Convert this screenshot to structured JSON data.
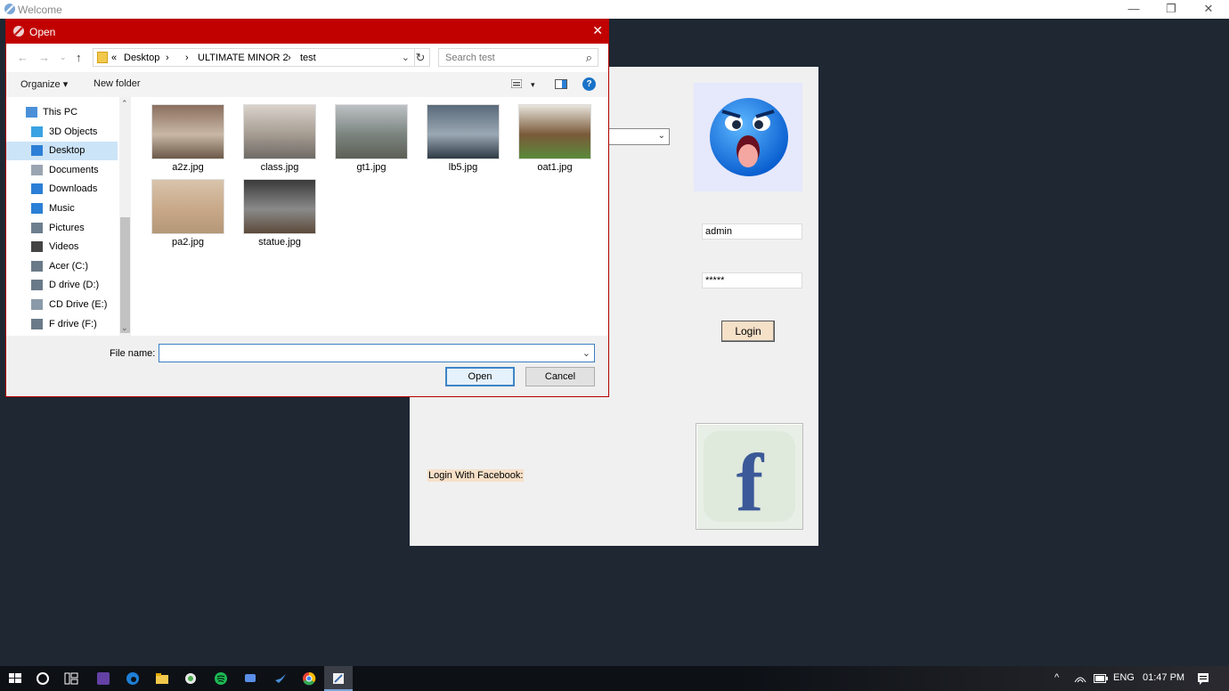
{
  "main_window": {
    "title": "Welcome",
    "minimize": "—",
    "maximize": "❐",
    "close": "✕"
  },
  "login_form": {
    "username_value": "admin",
    "password_value": "*****",
    "login_label": "Login",
    "facebook_label": "Login With Facebook:",
    "facebook_letter": "f"
  },
  "open_dialog": {
    "title": "Open",
    "close": "✕",
    "back": "←",
    "forward": "→",
    "recent": "⌄",
    "up": "↑",
    "breadcrumb": {
      "overflow": "«",
      "part1": "Desktop",
      "sep": "›",
      "part2": "ULTIMATE MINOR 2",
      "part3": "test"
    },
    "refresh": "↻",
    "search_placeholder": "Search test",
    "organize_label": "Organize ▾",
    "new_folder_label": "New folder",
    "view_options": "▾",
    "help": "?",
    "nav_items": [
      {
        "label": "This PC",
        "color": "#4a90d9"
      },
      {
        "label": "3D Objects",
        "color": "#3aa3e3"
      },
      {
        "label": "Desktop",
        "color": "#2c7fd6"
      },
      {
        "label": "Documents",
        "color": "#9aa5b1"
      },
      {
        "label": "Downloads",
        "color": "#2c7fd6"
      },
      {
        "label": "Music",
        "color": "#2c7fd6"
      },
      {
        "label": "Pictures",
        "color": "#6d7e8f"
      },
      {
        "label": "Videos",
        "color": "#444"
      },
      {
        "label": "Acer (C:)",
        "color": "#6a7a88"
      },
      {
        "label": "D drive (D:)",
        "color": "#6a7a88"
      },
      {
        "label": "CD Drive (E:)",
        "color": "#8a9aa8"
      },
      {
        "label": "F drive (F:)",
        "color": "#6a7a88"
      }
    ],
    "files": [
      {
        "name": "a2z.jpg",
        "colors": [
          "#8a6e5e",
          "#c9b8a6",
          "#6b5848"
        ]
      },
      {
        "name": "class.jpg",
        "colors": [
          "#d9d3cc",
          "#a69c92",
          "#6e6a66"
        ]
      },
      {
        "name": "gt1.jpg",
        "colors": [
          "#bcc1c4",
          "#7c8480",
          "#5c5f55"
        ]
      },
      {
        "name": "lb5.jpg",
        "colors": [
          "#5a6a7a",
          "#9aa8b4",
          "#2e3a44"
        ]
      },
      {
        "name": "oat1.jpg",
        "colors": [
          "#e8e4dc",
          "#7a5a3a",
          "#5a8a3a"
        ]
      },
      {
        "name": "pa2.jpg",
        "colors": [
          "#d8c4ac",
          "#c8a888",
          "#b49878"
        ]
      },
      {
        "name": "statue.jpg",
        "colors": [
          "#3a3a3a",
          "#8a8a8a",
          "#5c4a3a"
        ]
      }
    ],
    "file_name_label": "File name:",
    "file_name_value": "",
    "open_label": "Open",
    "cancel_label": "Cancel"
  },
  "taskbar": {
    "tray_up": "^",
    "language": "ENG",
    "time": "01:47 PM"
  }
}
